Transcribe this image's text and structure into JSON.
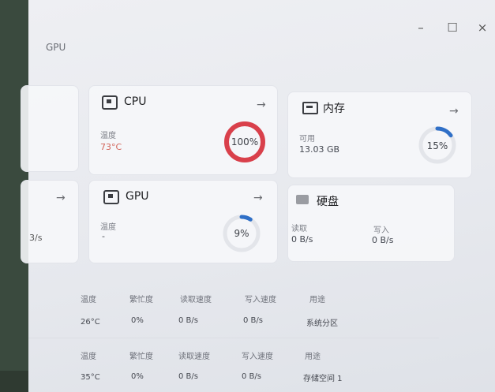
{
  "window": {
    "breadcrumb": "GPU",
    "controls": {
      "minimize": "–",
      "maximize": "☐",
      "close": "×"
    }
  },
  "cards": {
    "cpu": {
      "title": "CPU",
      "arrow": "→",
      "temp_label": "温度",
      "temp_value": "73°C",
      "usage_pct": "100%",
      "usage_value": 1.0
    },
    "memory": {
      "title": "内存",
      "arrow": "→",
      "avail_label": "可用",
      "avail_value": "13.03 GB",
      "usage_pct": "15%",
      "usage_value": 0.15
    },
    "gpu": {
      "title": "GPU",
      "arrow": "→",
      "temp_label": "温度",
      "temp_value": "-",
      "usage_pct": "9%",
      "usage_value": 0.09
    },
    "disk": {
      "title": "硬盘",
      "read_label": "读取",
      "read_value": "0 B/s",
      "write_label": "写入",
      "write_value": "0 B/s"
    },
    "left_partial": {
      "arrow": "→",
      "speed_fragment": "3/s"
    }
  },
  "disks": [
    {
      "headers": [
        "温度",
        "繁忙度",
        "读取速度",
        "写入速度",
        "用途"
      ],
      "values": [
        "26°C",
        "0%",
        "0 B/s",
        "0 B/s",
        "系统分区"
      ]
    },
    {
      "headers": [
        "温度",
        "繁忙度",
        "读取速度",
        "写入速度",
        "用途"
      ],
      "values": [
        "35°C",
        "0%",
        "0 B/s",
        "0 B/s",
        "存储空间 1"
      ]
    }
  ],
  "colors": {
    "cpu_ring": "#d9404b",
    "ring_track": "#e3e5ea",
    "ring_active": "#2f6fc7",
    "hot_temp": "#d2665c"
  },
  "icons": {
    "cpu": "chip-icon",
    "memory": "memory-icon",
    "gpu": "chip-icon",
    "disk": "disk-icon"
  }
}
